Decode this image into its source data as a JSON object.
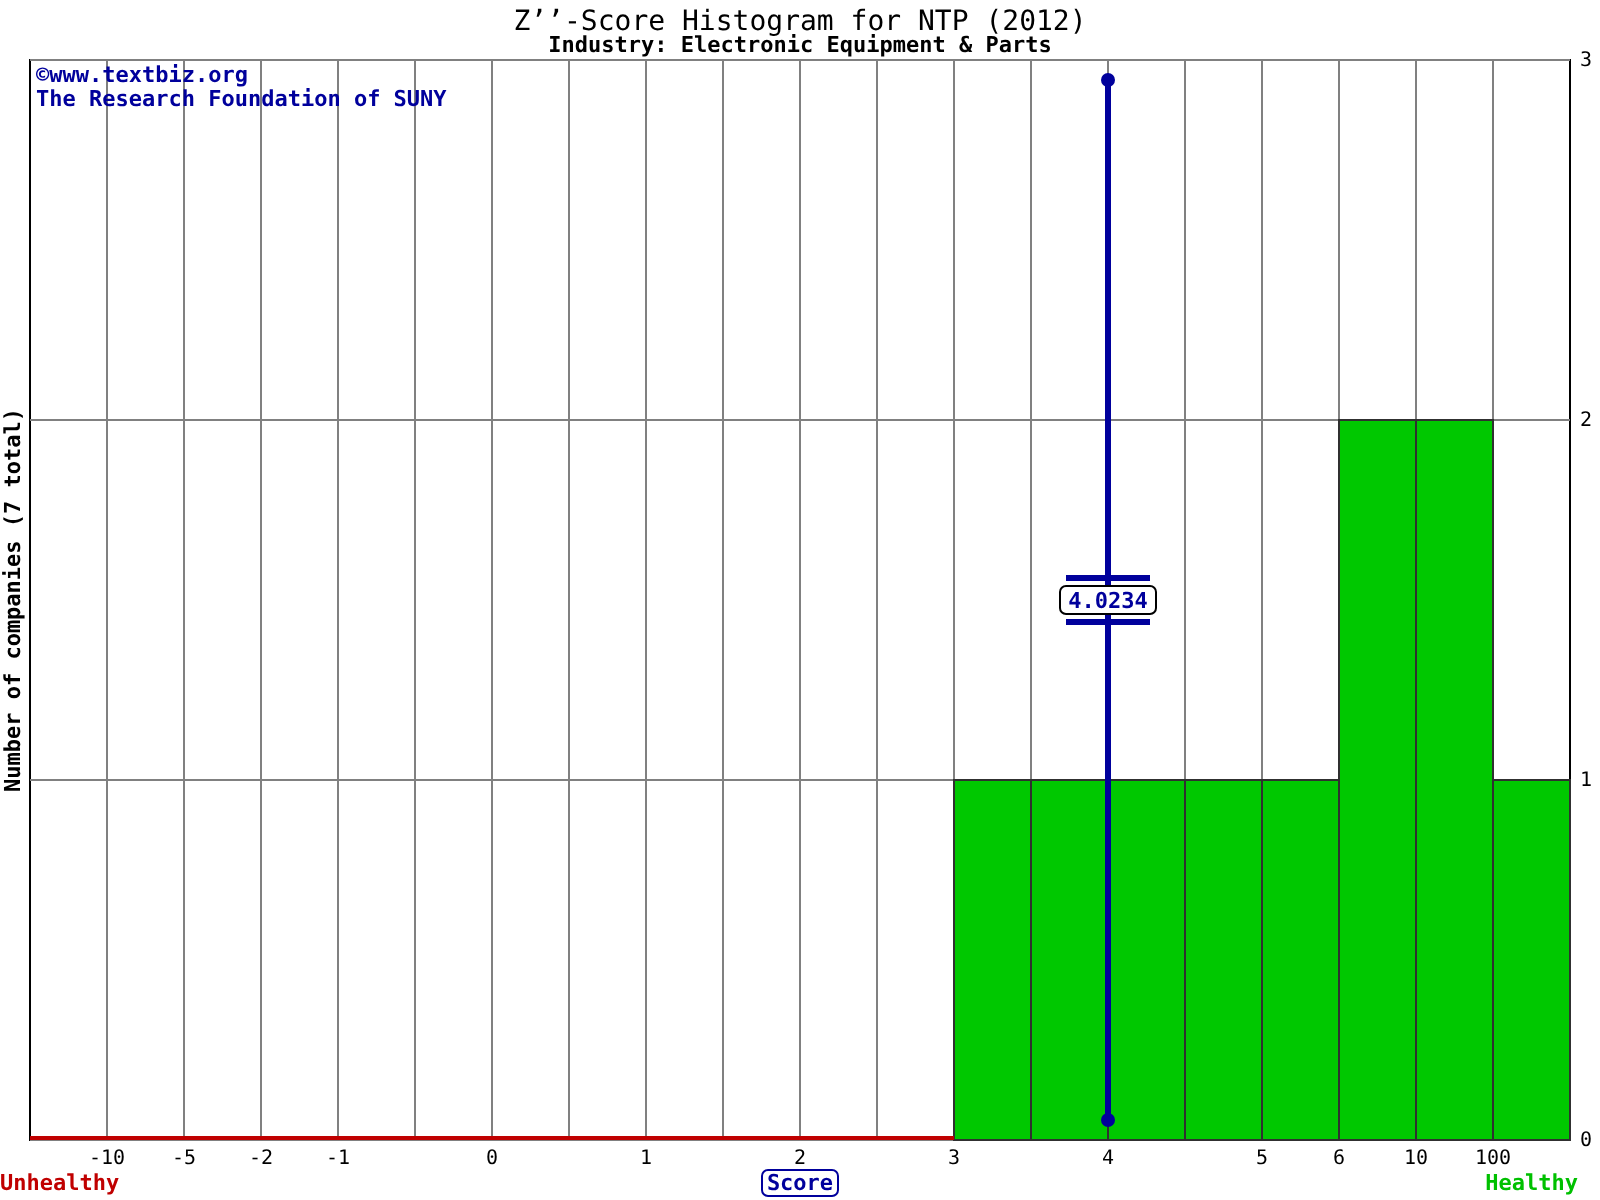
{
  "chart": {
    "title": "Z’’-Score Histogram for NTP (2012)",
    "subtitle": "Industry: Electronic Equipment & Parts",
    "credits": [
      "©www.textbiz.org",
      "The Research Foundation of SUNY"
    ],
    "zones": {
      "left": "Unhealthy",
      "right": "Healthy"
    },
    "x_axis_labels": [
      "-10",
      "-5",
      "-2",
      "-1",
      "0",
      "1",
      "2",
      "3",
      "4",
      "5",
      "6",
      "10",
      "100"
    ],
    "marker": {
      "label": "4.0234"
    },
    "chart_data": {
      "type": "bar",
      "xlabel": "Score",
      "ylabel": "Number of companies (7 total)",
      "categories": [
        null,
        null,
        null,
        null,
        null,
        null,
        null,
        null,
        null,
        null,
        null,
        null,
        null,
        null,
        null,
        null,
        null,
        null,
        null,
        null
      ],
      "values": [
        0,
        0,
        0,
        0,
        0,
        0,
        0,
        0,
        0,
        0,
        0,
        0,
        1,
        1,
        1,
        1,
        1,
        2,
        2,
        1
      ],
      "ylim": [
        0,
        3
      ],
      "yticks": [
        0,
        1,
        2,
        3
      ]
    }
  }
}
